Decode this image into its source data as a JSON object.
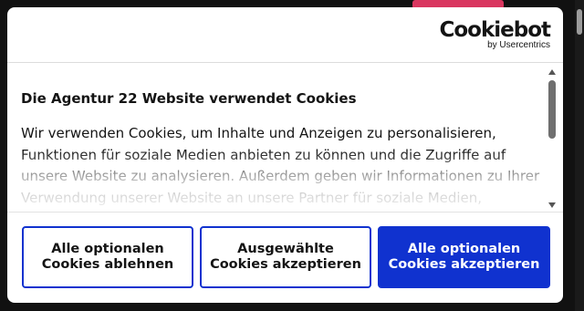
{
  "brand": {
    "logo_word": "Cookiebot",
    "logo_sub": "by Usercentrics"
  },
  "consent": {
    "title": "Die Agentur 22 Website verwendet Cookies",
    "body": "Wir verwenden Cookies, um Inhalte und Anzeigen zu personalisieren, Funktionen für soziale Medien anbieten zu können und die Zugriffe auf unsere Website zu analysieren. Außerdem geben wir Informationen zu Ihrer Verwendung unserer Website an unsere Partner für soziale Medien, Werbung"
  },
  "buttons": {
    "reject_all": "Alle optionalen Cookies ablehnen",
    "accept_selected": "Ausgewählte Cookies akzeptieren",
    "accept_all": "Alle optionalen Cookies akzeptieren"
  },
  "colors": {
    "accent": "#1032cf",
    "backdrop": "#111111",
    "highlight_bar": "#d9365f"
  }
}
